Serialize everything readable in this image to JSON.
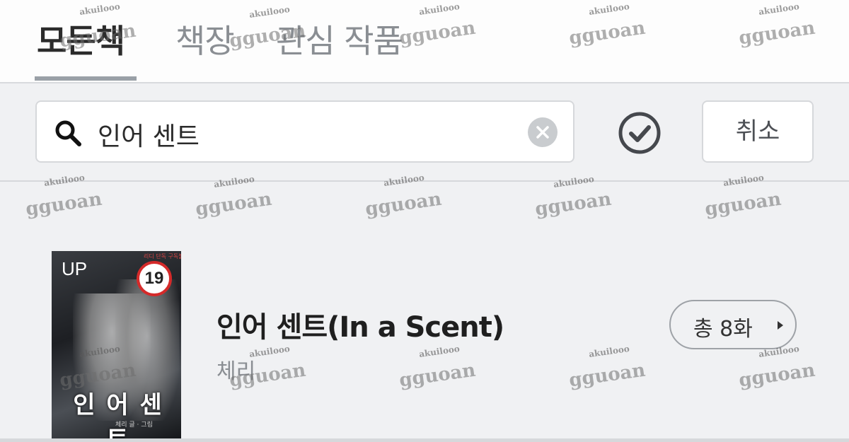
{
  "tabs": [
    {
      "label": "모든책",
      "active": true
    },
    {
      "label": "책장",
      "active": false
    },
    {
      "label": "관심 작품",
      "active": false
    }
  ],
  "search": {
    "query": "인어 센트",
    "icon": "search-icon",
    "clear_icon": "close-circle-icon"
  },
  "confirm_icon": "check-circle-icon",
  "cancel_label": "취소",
  "result": {
    "title": "인어 센트(In a Scent)",
    "author": "체리",
    "episodes_label": "총 8화",
    "cover": {
      "badge": "UP",
      "age_rating": "19",
      "corner_text": "리디 단독 구독불가",
      "title": "인 어 센 트",
      "subtitle": "체리 글 · 그림"
    }
  },
  "watermarks": {
    "small": "akuilooo",
    "big": "gguoan"
  },
  "colors": {
    "background": "#f0f1f3",
    "tab_active": "#2b2b2b",
    "tab_inactive": "#8a8e93",
    "age_badge_border": "#d52a2a"
  }
}
